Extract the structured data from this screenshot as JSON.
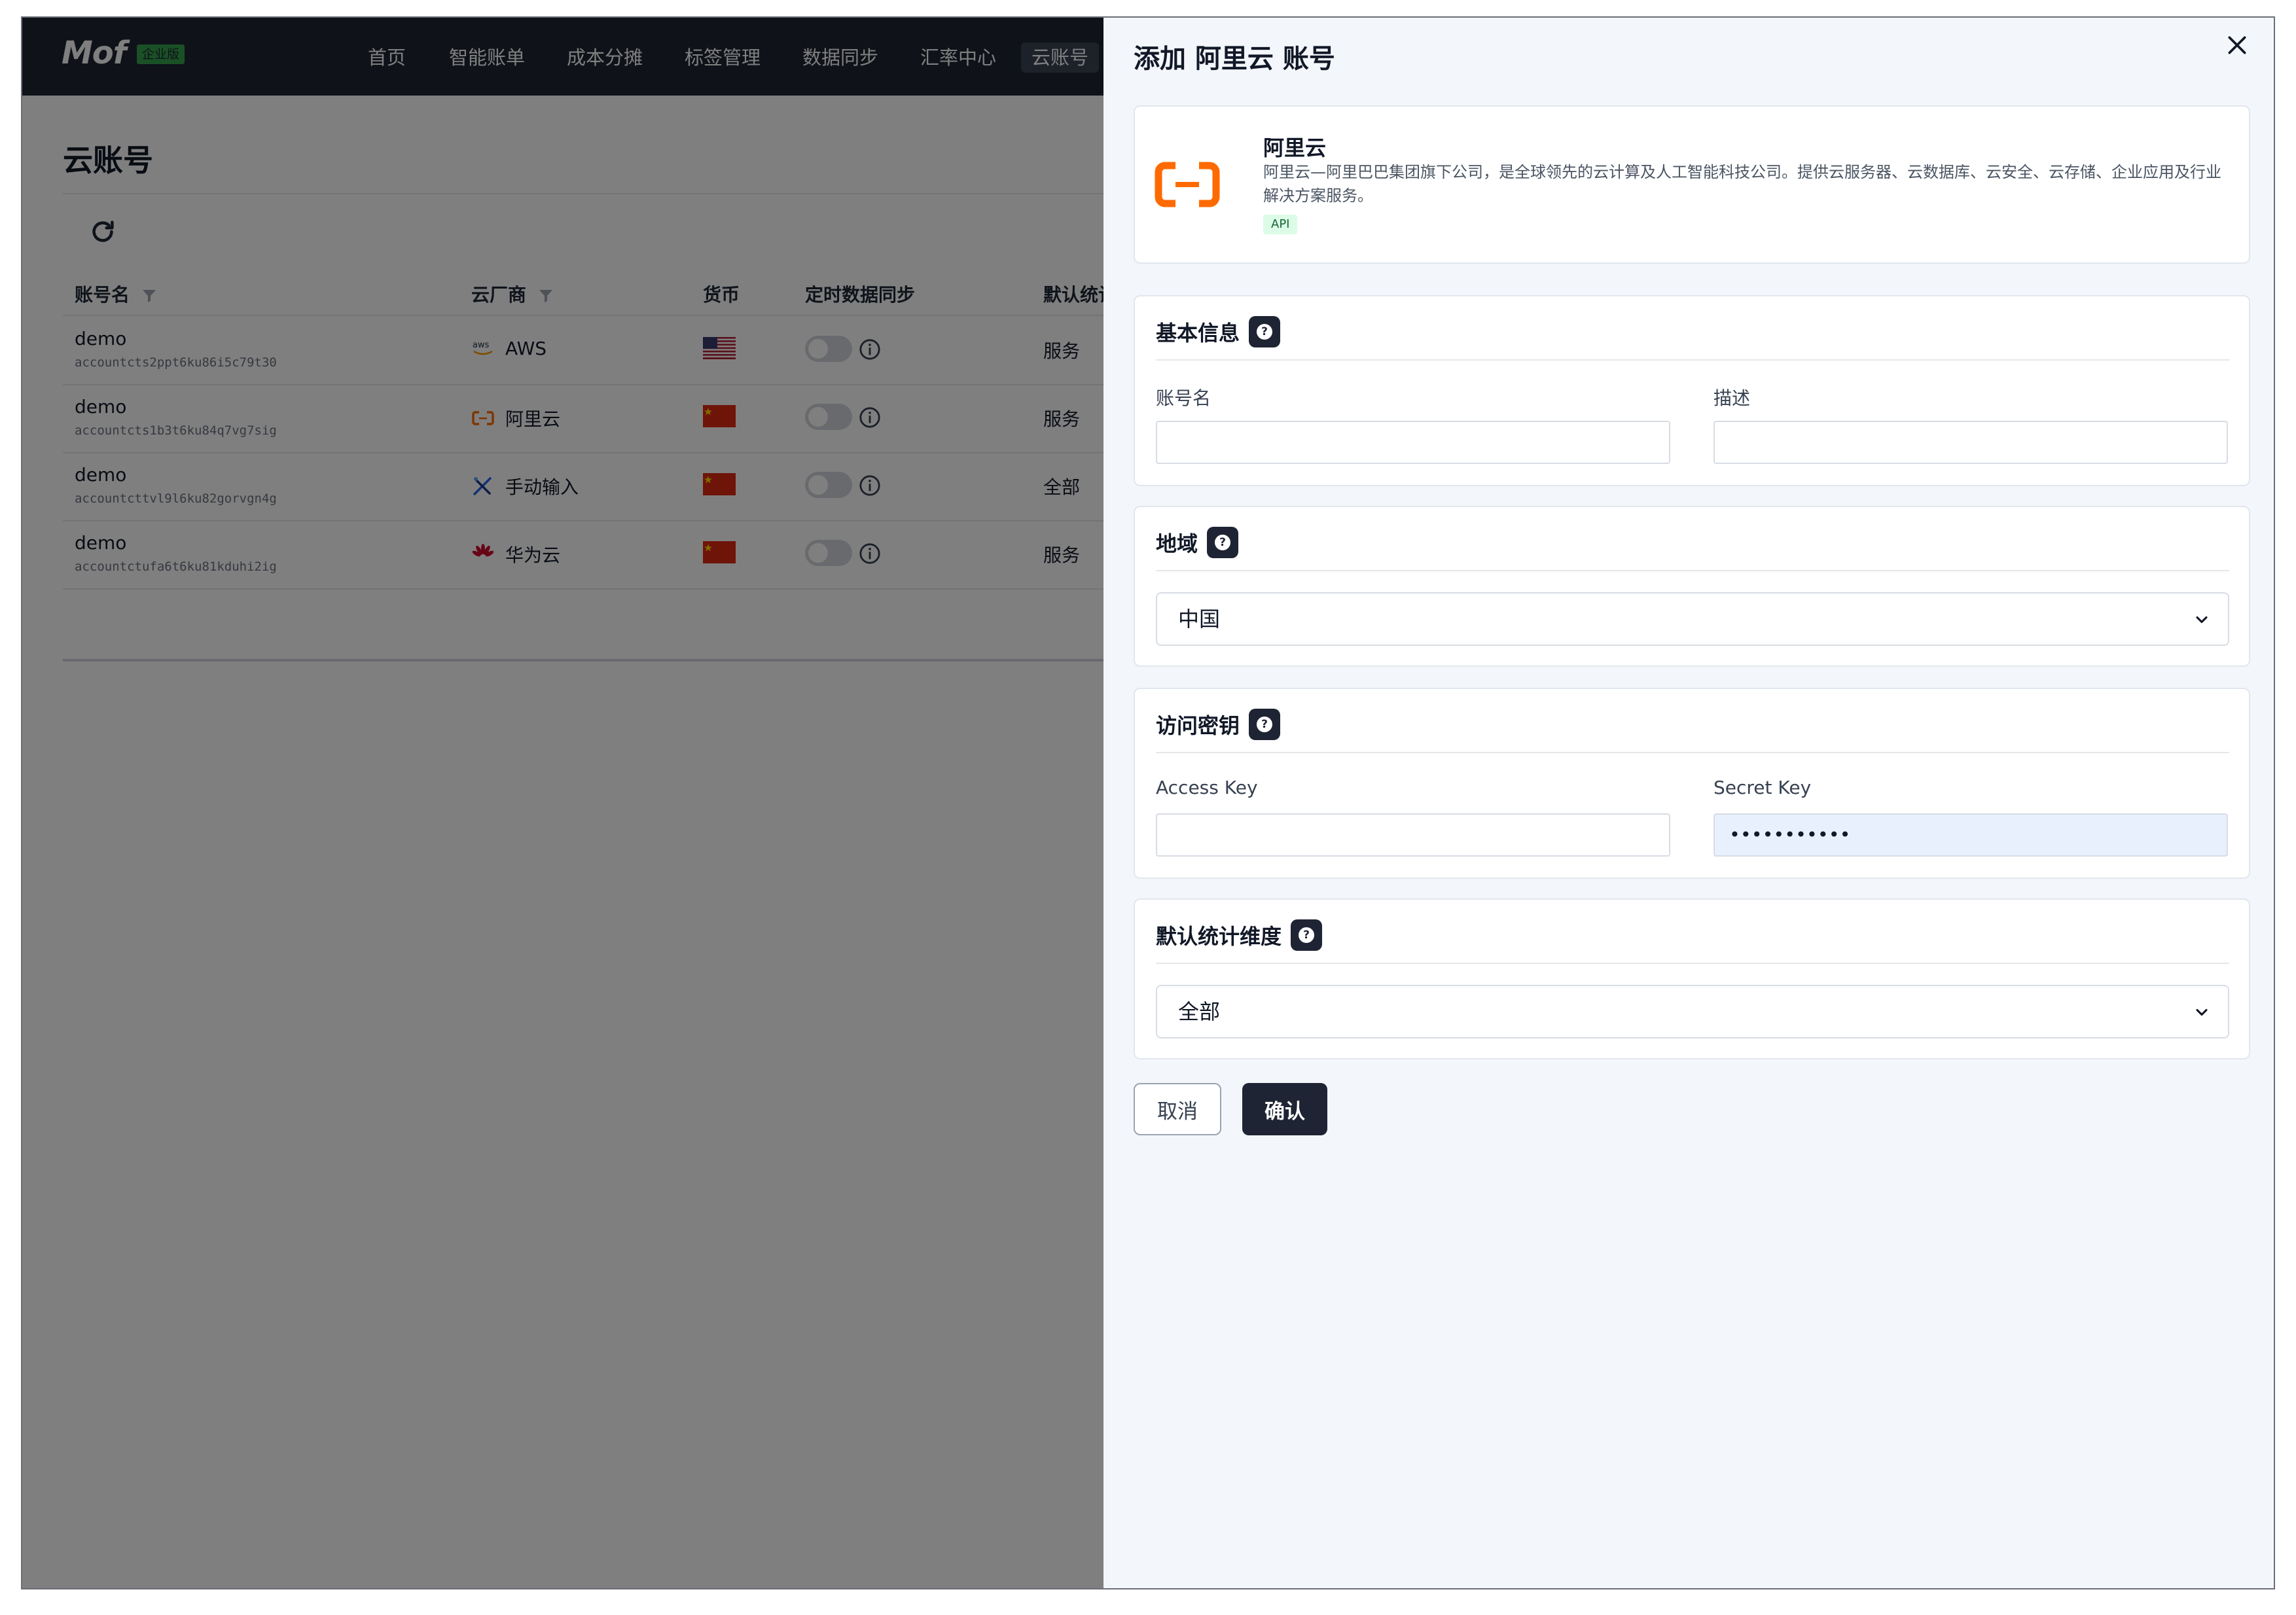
{
  "nav": {
    "logo": "Mof",
    "edition": "企业版",
    "items": [
      "首页",
      "智能账单",
      "成本分摊",
      "标签管理",
      "数据同步",
      "汇率中心",
      "云账号"
    ],
    "active_index": 6
  },
  "page": {
    "title": "云账号",
    "table": {
      "headers": [
        "账号名",
        "云厂商",
        "货币",
        "定时数据同步",
        "默认统计"
      ],
      "rows": [
        {
          "name": "demo",
          "id": "accountcts2ppt6ku86i5c79t30",
          "vendor": "AWS",
          "vendor_icon": "aws-icon",
          "currency_icon": "us-flag-icon",
          "sync_enabled": false,
          "stat": "服务"
        },
        {
          "name": "demo",
          "id": "accountcts1b3t6ku84q7vg7sig",
          "vendor": "阿里云",
          "vendor_icon": "aliyun-icon",
          "currency_icon": "cn-flag-icon",
          "sync_enabled": false,
          "stat": "服务"
        },
        {
          "name": "demo",
          "id": "accountcttvl9l6ku82gorvgn4g",
          "vendor": "手动输入",
          "vendor_icon": "manual-input-icon",
          "currency_icon": "cn-flag-icon",
          "sync_enabled": false,
          "stat": "全部"
        },
        {
          "name": "demo",
          "id": "accountctufa6t6ku81kduhi2ig",
          "vendor": "华为云",
          "vendor_icon": "huawei-icon",
          "currency_icon": "cn-flag-icon",
          "sync_enabled": false,
          "stat": "服务"
        }
      ]
    }
  },
  "drawer": {
    "title": "添加 阿里云 账号",
    "provider": {
      "name": "阿里云",
      "description": "阿里云—阿里巴巴集团旗下公司，是全球领先的云计算及人工智能科技公司。提供云服务器、云数据库、云安全、云存储、企业应用及行业解决方案服务。",
      "badge": "API"
    },
    "basic_info": {
      "title": "基本信息",
      "account_name_label": "账号名",
      "account_name_value": "",
      "description_label": "描述",
      "description_value": ""
    },
    "region": {
      "title": "地域",
      "selected": "中国"
    },
    "access": {
      "title": "访问密钥",
      "access_key_label": "Access Key",
      "access_key_value": "",
      "secret_key_label": "Secret Key",
      "secret_key_value": "•••••••••••"
    },
    "dimension": {
      "title": "默认统计维度",
      "selected": "全部"
    },
    "buttons": {
      "cancel": "取消",
      "confirm": "确认"
    }
  },
  "colors": {
    "nav_bg": "#1e2433",
    "aliyun_orange": "#ff6a00",
    "autofill_bg": "#e8f0fe"
  }
}
